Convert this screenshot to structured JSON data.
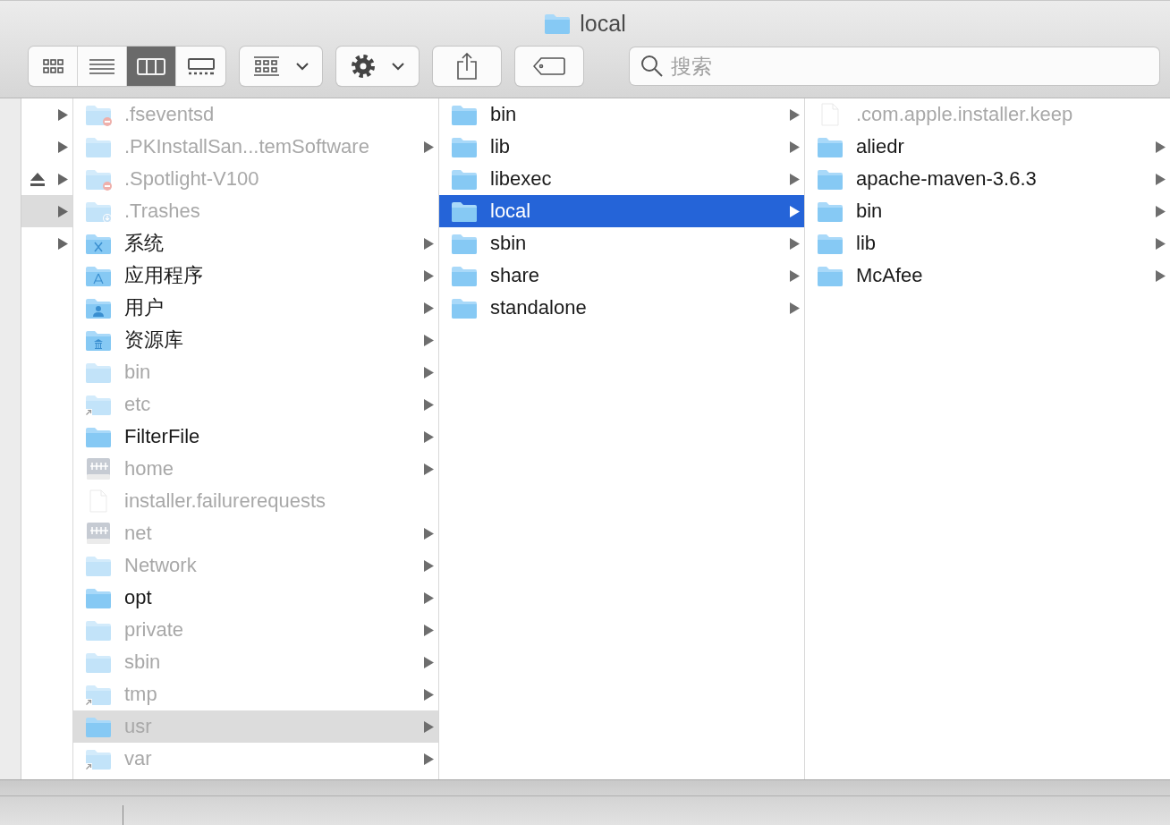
{
  "window": {
    "title": "local"
  },
  "toolbar": {
    "view_modes": [
      {
        "kind": "icons",
        "selected": false
      },
      {
        "kind": "list",
        "selected": false
      },
      {
        "kind": "columns",
        "selected": true
      },
      {
        "kind": "gallery",
        "selected": false
      }
    ],
    "search": {
      "placeholder": "搜索"
    }
  },
  "volume_column": {
    "items": [
      {
        "eject": false,
        "selected": false
      },
      {
        "eject": false,
        "selected": false
      },
      {
        "eject": true,
        "selected": false
      },
      {
        "eject": false,
        "selected": true
      },
      {
        "eject": false,
        "selected": false
      }
    ]
  },
  "columns": [
    {
      "focused": false,
      "items": [
        {
          "name": ".fseventsd",
          "kind": "restricted",
          "dimmed": true,
          "has_children": false,
          "selected": false
        },
        {
          "name": ".PKInstallSan...temSoftware",
          "kind": "folder",
          "dimmed": true,
          "has_children": true,
          "selected": false
        },
        {
          "name": ".Spotlight-V100",
          "kind": "restricted",
          "dimmed": true,
          "has_children": false,
          "selected": false
        },
        {
          "name": ".Trashes",
          "kind": "download",
          "dimmed": true,
          "has_children": false,
          "selected": false
        },
        {
          "name": "系统",
          "kind": "system",
          "dimmed": false,
          "has_children": true,
          "selected": false
        },
        {
          "name": "应用程序",
          "kind": "apps",
          "dimmed": false,
          "has_children": true,
          "selected": false
        },
        {
          "name": "用户",
          "kind": "users",
          "dimmed": false,
          "has_children": true,
          "selected": false
        },
        {
          "name": "资源库",
          "kind": "library",
          "dimmed": false,
          "has_children": true,
          "selected": false
        },
        {
          "name": "bin",
          "kind": "folder",
          "dimmed": true,
          "has_children": true,
          "selected": false
        },
        {
          "name": "etc",
          "kind": "alias",
          "dimmed": true,
          "has_children": true,
          "selected": false
        },
        {
          "name": "FilterFile",
          "kind": "folder",
          "dimmed": false,
          "has_children": true,
          "selected": false
        },
        {
          "name": "home",
          "kind": "server",
          "dimmed": true,
          "has_children": true,
          "selected": false
        },
        {
          "name": "installer.failurerequests",
          "kind": "document",
          "dimmed": true,
          "has_children": false,
          "selected": false
        },
        {
          "name": "net",
          "kind": "server",
          "dimmed": true,
          "has_children": true,
          "selected": false
        },
        {
          "name": "Network",
          "kind": "folder",
          "dimmed": true,
          "has_children": true,
          "selected": false
        },
        {
          "name": "opt",
          "kind": "folder",
          "dimmed": false,
          "has_children": true,
          "selected": false
        },
        {
          "name": "private",
          "kind": "folder",
          "dimmed": true,
          "has_children": true,
          "selected": false
        },
        {
          "name": "sbin",
          "kind": "folder",
          "dimmed": true,
          "has_children": true,
          "selected": false
        },
        {
          "name": "tmp",
          "kind": "alias",
          "dimmed": true,
          "has_children": true,
          "selected": false
        },
        {
          "name": "usr",
          "kind": "folder",
          "dimmed": true,
          "has_children": true,
          "selected": true
        },
        {
          "name": "var",
          "kind": "alias",
          "dimmed": true,
          "has_children": true,
          "selected": false
        }
      ]
    },
    {
      "focused": true,
      "items": [
        {
          "name": "bin",
          "kind": "folder",
          "dimmed": false,
          "has_children": true,
          "selected": false
        },
        {
          "name": "lib",
          "kind": "folder",
          "dimmed": false,
          "has_children": true,
          "selected": false
        },
        {
          "name": "libexec",
          "kind": "folder",
          "dimmed": false,
          "has_children": true,
          "selected": false
        },
        {
          "name": "local",
          "kind": "folder",
          "dimmed": false,
          "has_children": true,
          "selected": true
        },
        {
          "name": "sbin",
          "kind": "folder",
          "dimmed": false,
          "has_children": true,
          "selected": false
        },
        {
          "name": "share",
          "kind": "folder",
          "dimmed": false,
          "has_children": true,
          "selected": false
        },
        {
          "name": "standalone",
          "kind": "folder",
          "dimmed": false,
          "has_children": true,
          "selected": false
        }
      ]
    },
    {
      "items": [
        {
          "name": ".com.apple.installer.keep",
          "kind": "document",
          "dimmed": true,
          "has_children": false,
          "selected": false
        },
        {
          "name": "aliedr",
          "kind": "folder",
          "dimmed": false,
          "has_children": true,
          "selected": false
        },
        {
          "name": "apache-maven-3.6.3",
          "kind": "folder",
          "dimmed": false,
          "has_children": true,
          "selected": false
        },
        {
          "name": "bin",
          "kind": "folder",
          "dimmed": false,
          "has_children": true,
          "selected": false
        },
        {
          "name": "lib",
          "kind": "folder",
          "dimmed": false,
          "has_children": true,
          "selected": false
        },
        {
          "name": "McAfee",
          "kind": "folder",
          "dimmed": false,
          "has_children": true,
          "selected": false
        }
      ]
    }
  ]
}
